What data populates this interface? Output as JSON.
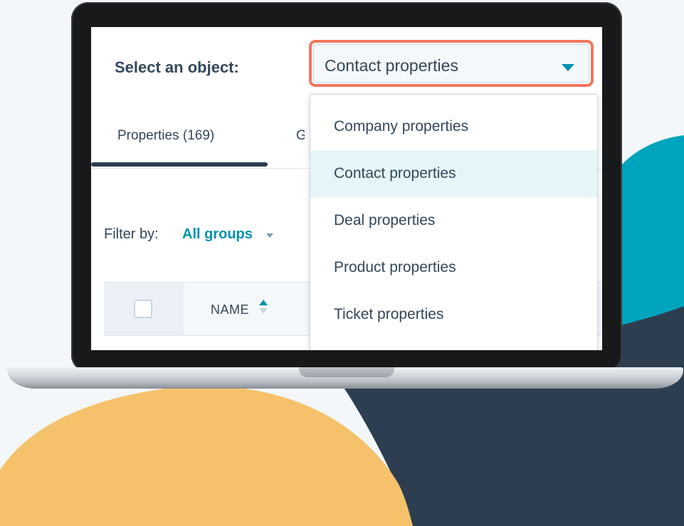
{
  "header": {
    "select_label": "Select an object:",
    "selected_value": "Contact properties"
  },
  "tabs": [
    {
      "label": "Properties (169)",
      "active": true
    },
    {
      "label": "G",
      "active": false
    }
  ],
  "filter": {
    "label": "Filter by:",
    "value": "All groups"
  },
  "table": {
    "columns": [
      "NAME"
    ],
    "sort": "ascending"
  },
  "dropdown": {
    "items": [
      {
        "label": "Company properties",
        "selected": false
      },
      {
        "label": "Contact properties",
        "selected": true
      },
      {
        "label": "Deal properties",
        "selected": false
      },
      {
        "label": "Product properties",
        "selected": false
      },
      {
        "label": "Ticket properties",
        "selected": false
      }
    ]
  },
  "colors": {
    "accent": "#0091ae",
    "highlight_border": "#f2765e",
    "text": "#33475b",
    "blob_teal": "#00a4bd",
    "blob_navy": "#2d3e50",
    "blob_yellow": "#f5c26b"
  }
}
